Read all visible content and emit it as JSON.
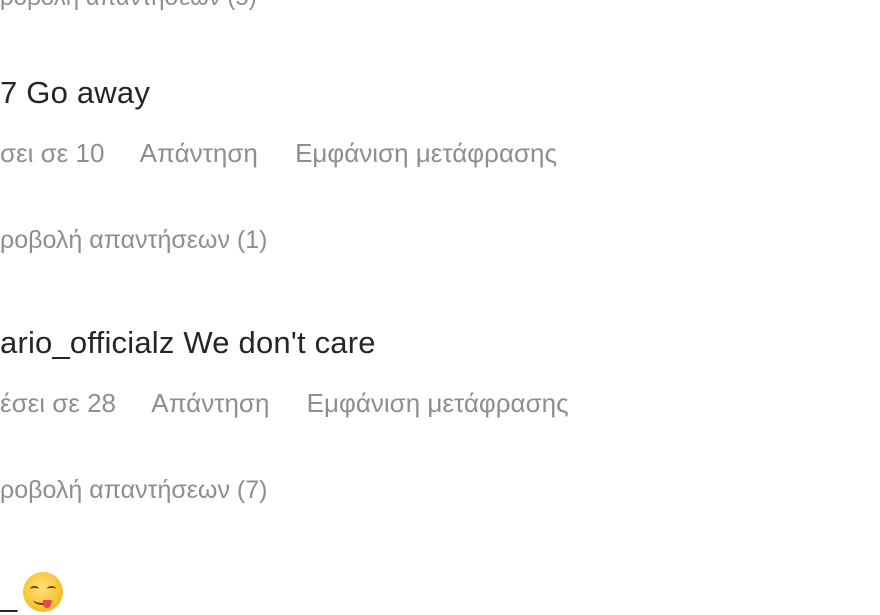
{
  "clipped_top_text": "ροβολή απαντήσεων (5)",
  "comments": [
    {
      "author": "7",
      "text": "Go away",
      "likes": "σει σε 10",
      "reply_label": "Απάντηση",
      "translate_label": "Εμφάνιση μετάφρασης",
      "view_replies": "ροβολή απαντήσεων (1)"
    },
    {
      "author": "ario_officialz",
      "text": "We don't care",
      "likes": "έσει σε 28",
      "reply_label": "Απάντηση",
      "translate_label": "Εμφάνιση μετάφρασης",
      "view_replies": "ροβολή απαντήσεων (7)"
    },
    {
      "author": "_",
      "emoji_icon": "savoring-food-emoji-icon"
    }
  ]
}
